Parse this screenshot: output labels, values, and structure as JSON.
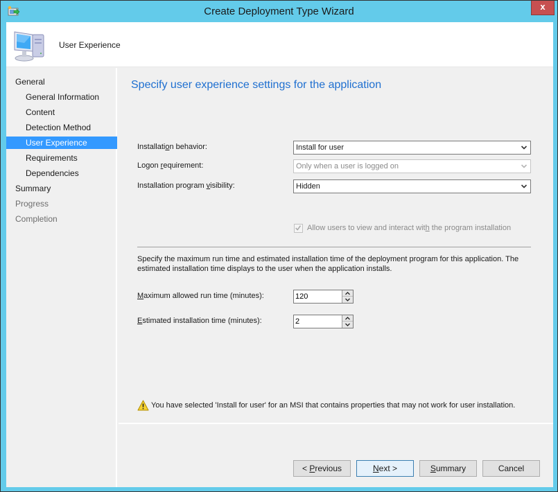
{
  "window": {
    "title": "Create Deployment Type Wizard",
    "close_label": "x"
  },
  "header": {
    "title": "User Experience",
    "icon": "computer-icon"
  },
  "nav": {
    "items": [
      {
        "label": "General",
        "level": 0,
        "state": "normal"
      },
      {
        "label": "General Information",
        "level": 1,
        "state": "normal"
      },
      {
        "label": "Content",
        "level": 1,
        "state": "normal"
      },
      {
        "label": "Detection Method",
        "level": 1,
        "state": "normal"
      },
      {
        "label": "User Experience",
        "level": 1,
        "state": "active"
      },
      {
        "label": "Requirements",
        "level": 1,
        "state": "normal"
      },
      {
        "label": "Dependencies",
        "level": 1,
        "state": "normal"
      },
      {
        "label": "Summary",
        "level": 0,
        "state": "normal"
      },
      {
        "label": "Progress",
        "level": 0,
        "state": "disabled"
      },
      {
        "label": "Completion",
        "level": 0,
        "state": "disabled"
      }
    ]
  },
  "main": {
    "heading": "Specify user experience settings for the application",
    "installation_behavior": {
      "label_pre": "Installati",
      "label_key": "o",
      "label_post": "n behavior:",
      "value": "Install for user"
    },
    "logon_requirement": {
      "label_pre": "Logon ",
      "label_key": "r",
      "label_post": "equirement:",
      "value": "Only when a user is logged on",
      "enabled": false
    },
    "program_visibility": {
      "label_pre": "Installation program ",
      "label_key": "v",
      "label_post": "isibility:",
      "value": "Hidden"
    },
    "allow_interact": {
      "label_pre": "Allow users to view and interact wit",
      "label_key": "h",
      "label_post": " the program installation",
      "checked": true,
      "enabled": false
    },
    "description": "Specify the maximum run time and estimated installation time of the deployment program for this application. The estimated installation time displays to the user when the application installs.",
    "max_run_time": {
      "label_key": "M",
      "label_post": "aximum allowed run time (minutes):",
      "value": "120"
    },
    "estimated_time": {
      "label_key": "E",
      "label_post": "stimated installation time (minutes):",
      "value": "2"
    },
    "warning": "You have selected 'Install for user' for an MSI that contains properties that may not work for user installation."
  },
  "buttons": {
    "previous": {
      "pre": "< ",
      "key": "P",
      "post": "revious"
    },
    "next": {
      "pre": "",
      "key": "N",
      "post": "ext >"
    },
    "summary": {
      "pre": "",
      "key": "S",
      "post": "ummary"
    },
    "cancel": {
      "pre": "Cancel",
      "key": "",
      "post": ""
    }
  },
  "colors": {
    "title_bar": "#63cbea",
    "close_button": "#c75050",
    "heading_text": "#1e6fd0",
    "nav_selected": "#3399ff"
  }
}
